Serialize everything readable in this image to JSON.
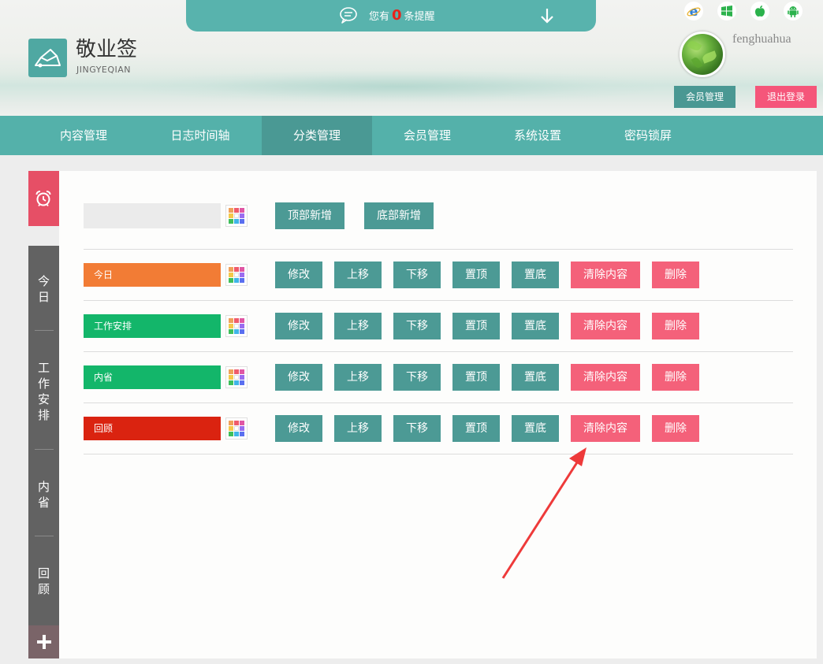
{
  "notice": {
    "prefix": "您有",
    "count": "0",
    "suffix": "条提醒"
  },
  "brand": {
    "title": "敬业签",
    "subtitle": "JINGYEQIAN"
  },
  "platform_icons": [
    "ie-icon",
    "windows-icon",
    "apple-icon",
    "android-icon"
  ],
  "user": {
    "name": "fenghuahua",
    "member_button": "会员管理",
    "logout_button": "退出登录"
  },
  "nav": {
    "tabs": [
      "内容管理",
      "日志时间轴",
      "分类管理",
      "会员管理",
      "系统设置",
      "密码锁屏"
    ],
    "active": "分类管理"
  },
  "sidebar": {
    "categories": [
      "今日",
      "工作安排",
      "内省",
      "回顾"
    ],
    "add_label": "+"
  },
  "toolbar": {
    "new_input_value": "",
    "add_top": "顶部新增",
    "add_bottom": "底部新增"
  },
  "row_actions": {
    "edit": "修改",
    "up": "上移",
    "down": "下移",
    "top": "置顶",
    "bottom": "置底",
    "clear": "清除内容",
    "delete": "删除"
  },
  "categories": [
    {
      "name": "今日",
      "color": "#f27c35"
    },
    {
      "name": "工作安排",
      "color": "#13b66a"
    },
    {
      "name": "内省",
      "color": "#13b66a"
    },
    {
      "name": "回顾",
      "color": "#da2310"
    }
  ],
  "colors": {
    "accent": "#54b1aa",
    "button_teal": "#4c9a95",
    "button_pink": "#f4617a",
    "annotation_arrow": "#ee3a3a"
  }
}
